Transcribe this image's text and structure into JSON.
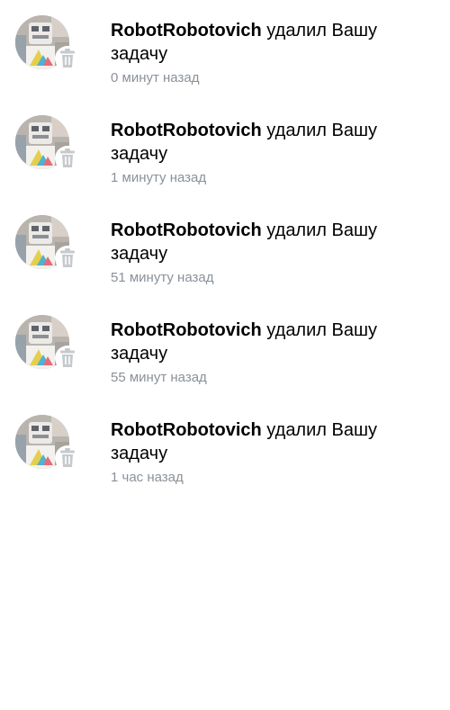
{
  "notifications": [
    {
      "user": "RobotRobotovich",
      "action": " удалил Вашу задачу",
      "time": "0 минут назад",
      "avatar_icon": "robot-avatar",
      "badge_icon": "trash-icon"
    },
    {
      "user": "RobotRobotovich",
      "action": " удалил Вашу задачу",
      "time": "1 минуту назад",
      "avatar_icon": "robot-avatar",
      "badge_icon": "trash-icon"
    },
    {
      "user": "RobotRobotovich",
      "action": " удалил Вашу задачу",
      "time": "51 минуту назад",
      "avatar_icon": "robot-avatar",
      "badge_icon": "trash-icon"
    },
    {
      "user": "RobotRobotovich",
      "action": " удалил Вашу задачу",
      "time": "55 минут назад",
      "avatar_icon": "robot-avatar",
      "badge_icon": "trash-icon"
    },
    {
      "user": "RobotRobotovich",
      "action": " удалил Вашу задачу",
      "time": "1 час назад",
      "avatar_icon": "robot-avatar",
      "badge_icon": "trash-icon"
    }
  ],
  "colors": {
    "time_text": "#8a9199",
    "trash_icon": "#c7cacd",
    "username_text": "#000000",
    "message_text": "#000000"
  }
}
